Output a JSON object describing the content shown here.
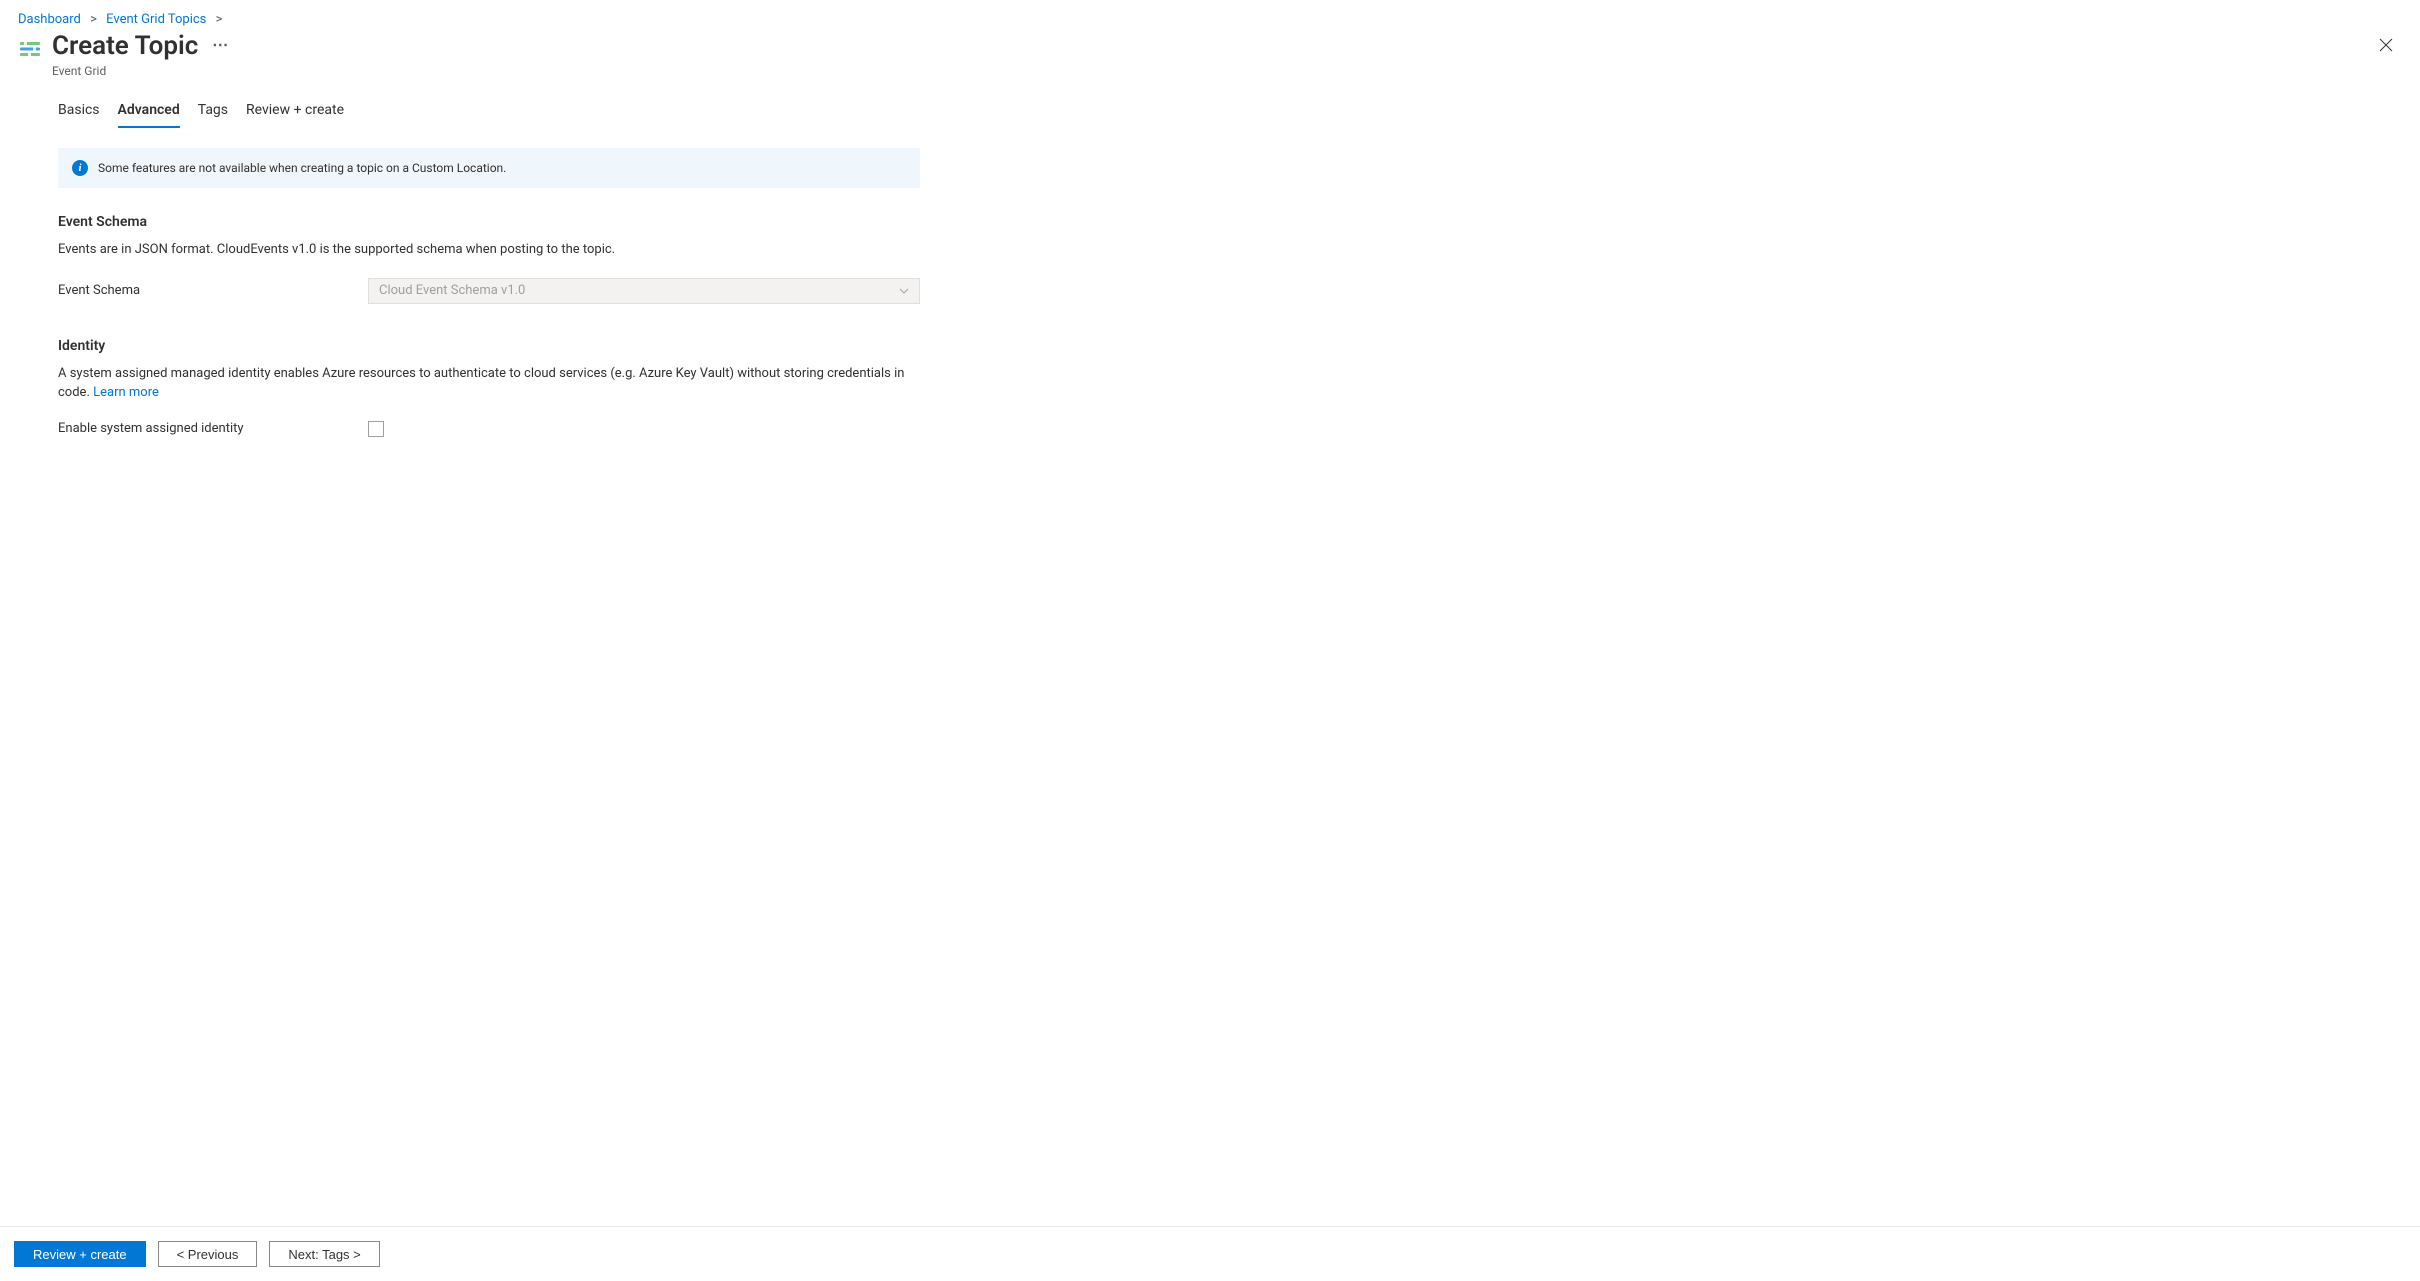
{
  "breadcrumb": {
    "items": [
      "Dashboard",
      "Event Grid Topics"
    ]
  },
  "header": {
    "title": "Create Topic",
    "subtitle": "Event Grid"
  },
  "tabs": [
    "Basics",
    "Advanced",
    "Tags",
    "Review + create"
  ],
  "active_tab": "Advanced",
  "banner": {
    "text": "Some features are not available when creating a topic on a Custom Location."
  },
  "sections": {
    "event_schema": {
      "title": "Event Schema",
      "desc": "Events are in JSON format. CloudEvents v1.0 is the supported schema when posting to the topic.",
      "label": "Event Schema",
      "value": "Cloud Event Schema v1.0"
    },
    "identity": {
      "title": "Identity",
      "desc": "A system assigned managed identity enables Azure resources to authenticate to cloud services (e.g. Azure Key Vault) without storing credentials in code. ",
      "learn_more": "Learn more",
      "checkbox_label": "Enable system assigned identity",
      "checkbox_checked": false
    }
  },
  "footer": {
    "review": "Review + create",
    "previous": "< Previous",
    "next": "Next: Tags >"
  }
}
